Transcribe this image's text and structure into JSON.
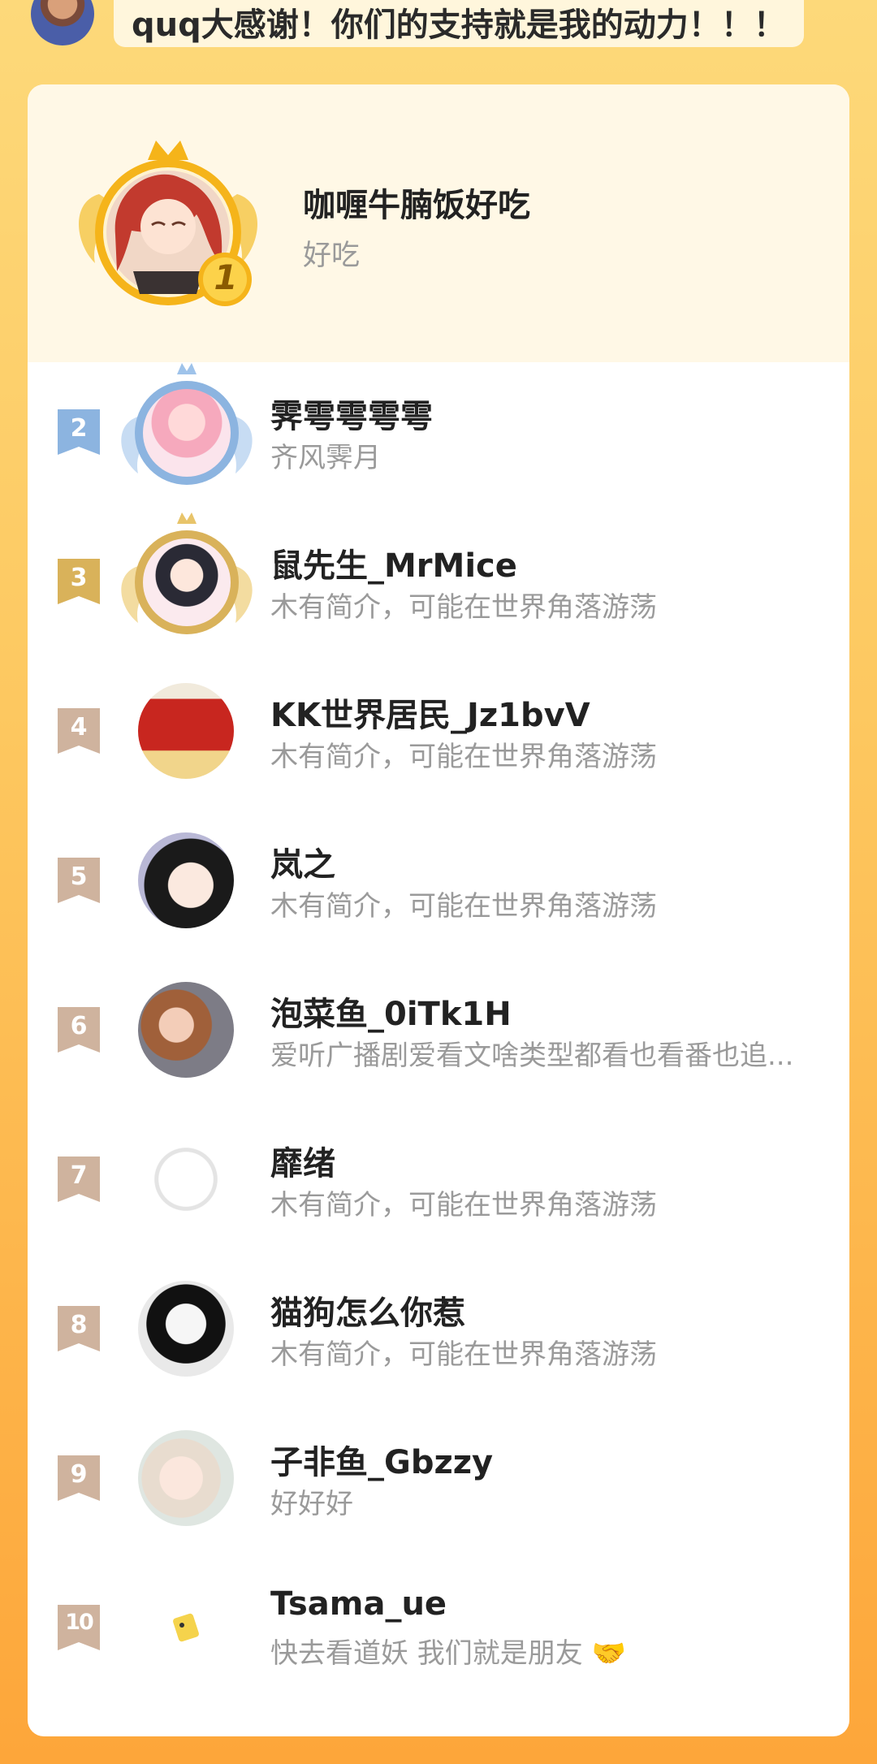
{
  "banner": {
    "message": "quq大感谢！你们的支持就是我的动力！！！"
  },
  "first": {
    "rank": "1",
    "name": "咖喱牛腩饭好吃",
    "bio": "好吃"
  },
  "rows": [
    {
      "rank": "2",
      "name": "霁雩雩雩雩",
      "bio": "齐风霁月"
    },
    {
      "rank": "3",
      "name": "鼠先生_MrMice",
      "bio": "木有简介，可能在世界角落游荡"
    },
    {
      "rank": "4",
      "name": "KK世界居民_Jz1bvV",
      "bio": "木有简介，可能在世界角落游荡"
    },
    {
      "rank": "5",
      "name": "岚之",
      "bio": "木有简介，可能在世界角落游荡"
    },
    {
      "rank": "6",
      "name": "泡菜鱼_0iTk1H",
      "bio": "爱听广播剧爱看文啥类型都看也看番也追..."
    },
    {
      "rank": "7",
      "name": "靡绪",
      "bio": "木有简介，可能在世界角落游荡"
    },
    {
      "rank": "8",
      "name": "猫狗怎么你惹",
      "bio": "木有简介，可能在世界角落游荡"
    },
    {
      "rank": "9",
      "name": "子非鱼_Gbzzy",
      "bio": "好好好"
    },
    {
      "rank": "10",
      "name": "Tsama_ue",
      "bio": "快去看道妖 我们就是朋友",
      "bio_emoji": "🤝"
    }
  ],
  "colors": {
    "gold": "#f3b519",
    "silver": "#8cb4e0",
    "bronze": "#d9b25a",
    "default_badge": "#cfb39e"
  }
}
